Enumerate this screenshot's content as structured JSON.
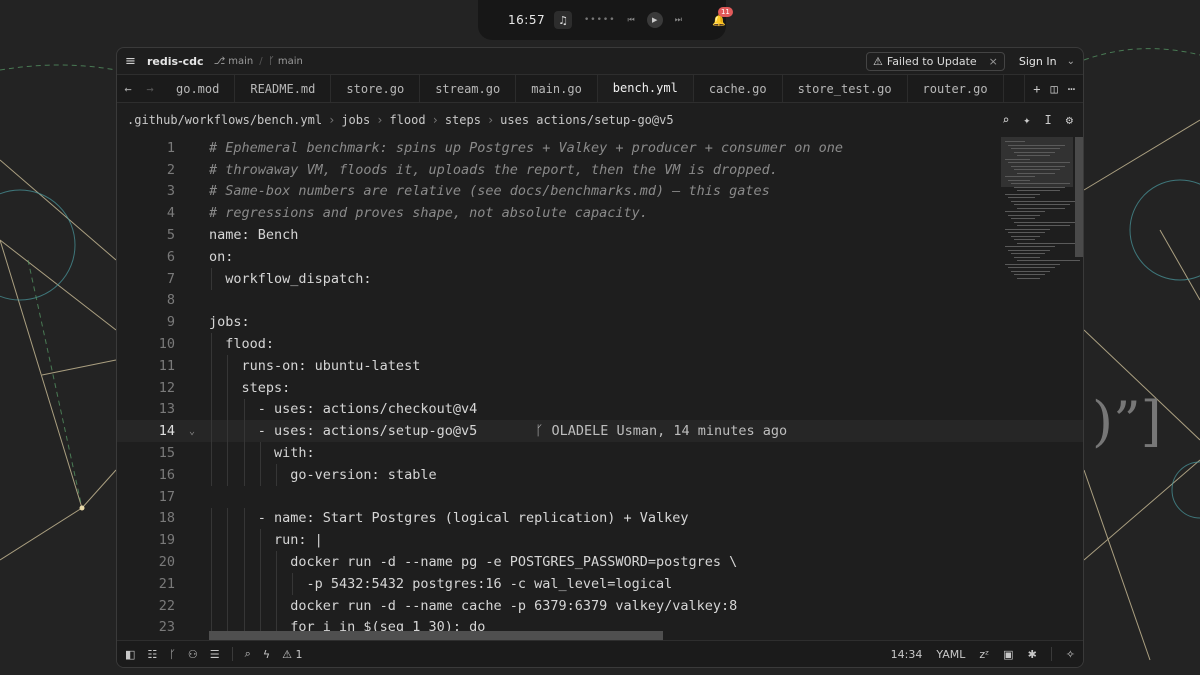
{
  "topbar": {
    "clock": "16:57",
    "music_icon": "music-note-icon",
    "notification_count": "11"
  },
  "titlebar": {
    "project": "redis-cdc",
    "branch1": "main",
    "branch2": "main",
    "update_label": "Failed to Update",
    "signin_label": "Sign In"
  },
  "tabs": [
    {
      "label": "go.mod"
    },
    {
      "label": "README.md"
    },
    {
      "label": "store.go"
    },
    {
      "label": "stream.go"
    },
    {
      "label": "main.go"
    },
    {
      "label": "bench.yml",
      "active": true
    },
    {
      "label": "cache.go"
    },
    {
      "label": "store_test.go"
    },
    {
      "label": "router.go"
    }
  ],
  "breadcrumbs": {
    "path": ".github/workflows/bench.yml",
    "items": [
      "jobs",
      "flood",
      "steps",
      "uses actions/setup-go@v5"
    ]
  },
  "editor": {
    "current_line": 14,
    "blame": "OLADELE Usman, 14 minutes ago",
    "lines": [
      {
        "n": "1",
        "indent": 0,
        "text": "# Ephemeral benchmark: spins up Postgres + Valkey + producer + consumer on one",
        "comment": true
      },
      {
        "n": "2",
        "indent": 0,
        "text": "# throwaway VM, floods it, uploads the report, then the VM is dropped.",
        "comment": true
      },
      {
        "n": "3",
        "indent": 0,
        "text": "# Same-box numbers are relative (see docs/benchmarks.md) — this gates",
        "comment": true
      },
      {
        "n": "4",
        "indent": 0,
        "text": "# regressions and proves shape, not absolute capacity.",
        "comment": true
      },
      {
        "n": "5",
        "indent": 0,
        "text": "name: Bench"
      },
      {
        "n": "6",
        "indent": 0,
        "text": "on:"
      },
      {
        "n": "7",
        "indent": 1,
        "text": "  workflow_dispatch:"
      },
      {
        "n": "8",
        "indent": 0,
        "text": ""
      },
      {
        "n": "9",
        "indent": 0,
        "text": "jobs:"
      },
      {
        "n": "10",
        "indent": 1,
        "text": "  flood:"
      },
      {
        "n": "11",
        "indent": 2,
        "text": "    runs-on: ubuntu-latest"
      },
      {
        "n": "12",
        "indent": 2,
        "text": "    steps:"
      },
      {
        "n": "13",
        "indent": 3,
        "text": "      - uses: actions/checkout@v4"
      },
      {
        "n": "14",
        "indent": 3,
        "text": "      - uses: actions/setup-go@v5"
      },
      {
        "n": "15",
        "indent": 4,
        "text": "        with:"
      },
      {
        "n": "16",
        "indent": 5,
        "text": "          go-version: stable"
      },
      {
        "n": "17",
        "indent": 0,
        "text": ""
      },
      {
        "n": "18",
        "indent": 3,
        "text": "      - name: Start Postgres (logical replication) + Valkey"
      },
      {
        "n": "19",
        "indent": 4,
        "text": "        run: |"
      },
      {
        "n": "20",
        "indent": 5,
        "text": "          docker run -d --name pg -e POSTGRES_PASSWORD=postgres \\"
      },
      {
        "n": "21",
        "indent": 6,
        "text": "            -p 5432:5432 postgres:16 -c wal_level=logical"
      },
      {
        "n": "22",
        "indent": 5,
        "text": "          docker run -d --name cache -p 6379:6379 valkey/valkey:8"
      },
      {
        "n": "23",
        "indent": 5,
        "text": "          for i in $(seq 1 30); do"
      }
    ]
  },
  "statusbar": {
    "diagnostics": "1",
    "cursor": "14:34",
    "language": "YAML"
  }
}
